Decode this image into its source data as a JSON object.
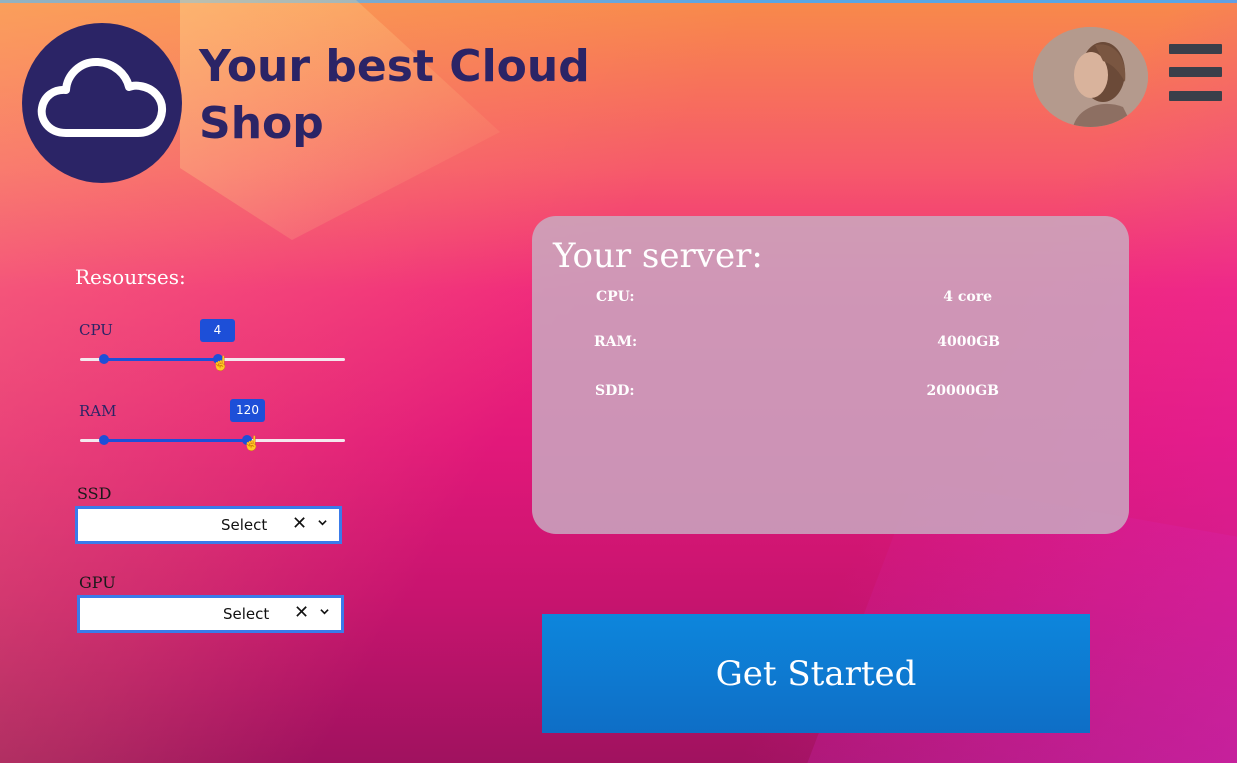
{
  "header": {
    "brand_name": "Your best Cloud Shop",
    "logo_icon": "cloud-icon",
    "avatar_alt": "user avatar",
    "menu_icon": "hamburger-menu-icon"
  },
  "resources": {
    "title": "Resourses:",
    "cpu": {
      "label": "CPU",
      "value": "4",
      "level": 0.52
    },
    "ram": {
      "label": "RAM",
      "value": "120",
      "level": 0.63
    },
    "ssd": {
      "label": "SSD",
      "placeholder": "Select"
    },
    "gpu": {
      "label": "GPU",
      "placeholder": "Select"
    }
  },
  "server": {
    "title": "Your server:",
    "specs": [
      {
        "key": "CPU:",
        "value": "4 core"
      },
      {
        "key": "RAM:",
        "value": "4000GB"
      },
      {
        "key": "SDD:",
        "value": "20000GB"
      }
    ]
  },
  "cta": {
    "label": "Get Started"
  },
  "colors": {
    "brand_navy": "#2b2466",
    "accent_blue": "#1d4fd8",
    "button_blue": "#0d86dc"
  }
}
